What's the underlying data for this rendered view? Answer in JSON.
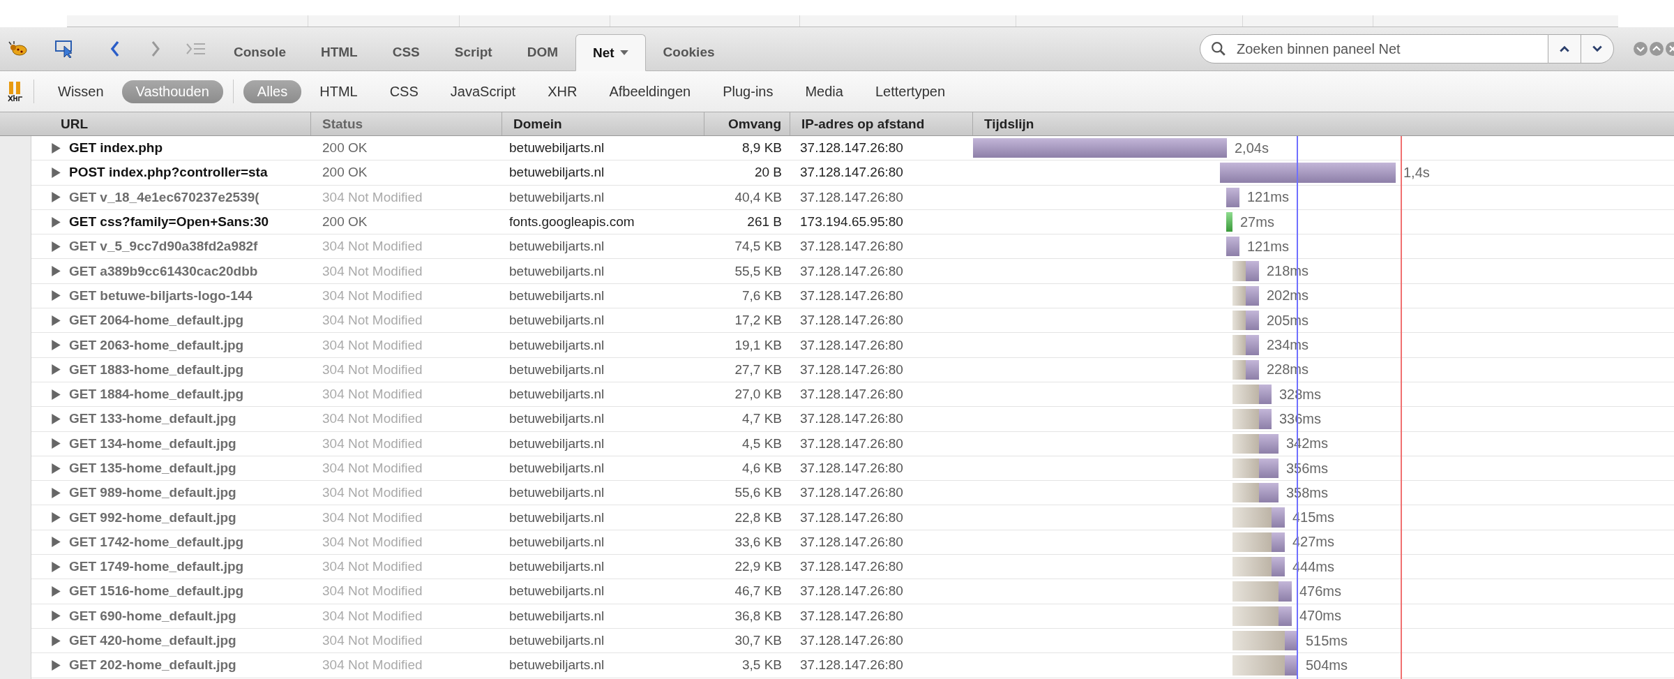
{
  "panel_tabs": [
    {
      "label": "Console",
      "selected": false
    },
    {
      "label": "HTML",
      "selected": false
    },
    {
      "label": "CSS",
      "selected": false
    },
    {
      "label": "Script",
      "selected": false
    },
    {
      "label": "DOM",
      "selected": false
    },
    {
      "label": "Net",
      "selected": true
    },
    {
      "label": "Cookies",
      "selected": false
    }
  ],
  "search": {
    "placeholder": "Zoeken binnen paneel Net"
  },
  "actions": [
    {
      "label": "Wissen",
      "selected": false
    },
    {
      "label": "Vasthouden",
      "selected": true
    }
  ],
  "filters": [
    {
      "label": "Alles",
      "selected": true
    },
    {
      "label": "HTML",
      "selected": false
    },
    {
      "label": "CSS",
      "selected": false
    },
    {
      "label": "JavaScript",
      "selected": false
    },
    {
      "label": "XHR",
      "selected": false
    },
    {
      "label": "Afbeeldingen",
      "selected": false
    },
    {
      "label": "Plug-ins",
      "selected": false
    },
    {
      "label": "Media",
      "selected": false
    },
    {
      "label": "Lettertypen",
      "selected": false
    }
  ],
  "table": {
    "columns": [
      "URL",
      "Status",
      "Domein",
      "Omvang",
      "IP-adres op afstand",
      "Tijdslijn"
    ],
    "rows": [
      {
        "url": "GET index.php",
        "status": "200 OK",
        "domain": "betuwebiljarts.nl",
        "size": "8,9 KB",
        "ip": "37.128.147.26:80",
        "time": "2,04s",
        "cached": false
      },
      {
        "url": "POST index.php?controller=sta",
        "status": "200 OK",
        "domain": "betuwebiljarts.nl",
        "size": "20 B",
        "ip": "37.128.147.26:80",
        "time": "1,4s",
        "cached": false
      },
      {
        "url": "GET v_18_4e1ec670237e2539(",
        "status": "304 Not Modified",
        "domain": "betuwebiljarts.nl",
        "size": "40,4 KB",
        "ip": "37.128.147.26:80",
        "time": "121ms",
        "cached": true
      },
      {
        "url": "GET css?family=Open+Sans:30",
        "status": "200 OK",
        "domain": "fonts.googleapis.com",
        "size": "261 B",
        "ip": "173.194.65.95:80",
        "time": "27ms",
        "cached": false
      },
      {
        "url": "GET v_5_9cc7d90a38fd2a982f",
        "status": "304 Not Modified",
        "domain": "betuwebiljarts.nl",
        "size": "74,5 KB",
        "ip": "37.128.147.26:80",
        "time": "121ms",
        "cached": true
      },
      {
        "url": "GET a389b9cc61430cac20dbb",
        "status": "304 Not Modified",
        "domain": "betuwebiljarts.nl",
        "size": "55,5 KB",
        "ip": "37.128.147.26:80",
        "time": "218ms",
        "cached": true
      },
      {
        "url": "GET betuwe-biljarts-logo-144",
        "status": "304 Not Modified",
        "domain": "betuwebiljarts.nl",
        "size": "7,6 KB",
        "ip": "37.128.147.26:80",
        "time": "202ms",
        "cached": true
      },
      {
        "url": "GET 2064-home_default.jpg",
        "status": "304 Not Modified",
        "domain": "betuwebiljarts.nl",
        "size": "17,2 KB",
        "ip": "37.128.147.26:80",
        "time": "205ms",
        "cached": true
      },
      {
        "url": "GET 2063-home_default.jpg",
        "status": "304 Not Modified",
        "domain": "betuwebiljarts.nl",
        "size": "19,1 KB",
        "ip": "37.128.147.26:80",
        "time": "234ms",
        "cached": true
      },
      {
        "url": "GET 1883-home_default.jpg",
        "status": "304 Not Modified",
        "domain": "betuwebiljarts.nl",
        "size": "27,7 KB",
        "ip": "37.128.147.26:80",
        "time": "228ms",
        "cached": true
      },
      {
        "url": "GET 1884-home_default.jpg",
        "status": "304 Not Modified",
        "domain": "betuwebiljarts.nl",
        "size": "27,0 KB",
        "ip": "37.128.147.26:80",
        "time": "328ms",
        "cached": true
      },
      {
        "url": "GET 133-home_default.jpg",
        "status": "304 Not Modified",
        "domain": "betuwebiljarts.nl",
        "size": "4,7 KB",
        "ip": "37.128.147.26:80",
        "time": "336ms",
        "cached": true
      },
      {
        "url": "GET 134-home_default.jpg",
        "status": "304 Not Modified",
        "domain": "betuwebiljarts.nl",
        "size": "4,5 KB",
        "ip": "37.128.147.26:80",
        "time": "342ms",
        "cached": true
      },
      {
        "url": "GET 135-home_default.jpg",
        "status": "304 Not Modified",
        "domain": "betuwebiljarts.nl",
        "size": "4,6 KB",
        "ip": "37.128.147.26:80",
        "time": "356ms",
        "cached": true
      },
      {
        "url": "GET 989-home_default.jpg",
        "status": "304 Not Modified",
        "domain": "betuwebiljarts.nl",
        "size": "55,6 KB",
        "ip": "37.128.147.26:80",
        "time": "358ms",
        "cached": true
      },
      {
        "url": "GET 992-home_default.jpg",
        "status": "304 Not Modified",
        "domain": "betuwebiljarts.nl",
        "size": "22,8 KB",
        "ip": "37.128.147.26:80",
        "time": "415ms",
        "cached": true
      },
      {
        "url": "GET 1742-home_default.jpg",
        "status": "304 Not Modified",
        "domain": "betuwebiljarts.nl",
        "size": "33,6 KB",
        "ip": "37.128.147.26:80",
        "time": "427ms",
        "cached": true
      },
      {
        "url": "GET 1749-home_default.jpg",
        "status": "304 Not Modified",
        "domain": "betuwebiljarts.nl",
        "size": "22,9 KB",
        "ip": "37.128.147.26:80",
        "time": "444ms",
        "cached": true
      },
      {
        "url": "GET 1516-home_default.jpg",
        "status": "304 Not Modified",
        "domain": "betuwebiljarts.nl",
        "size": "46,7 KB",
        "ip": "37.128.147.26:80",
        "time": "476ms",
        "cached": true
      },
      {
        "url": "GET 690-home_default.jpg",
        "status": "304 Not Modified",
        "domain": "betuwebiljarts.nl",
        "size": "36,8 KB",
        "ip": "37.128.147.26:80",
        "time": "470ms",
        "cached": true
      },
      {
        "url": "GET 420-home_default.jpg",
        "status": "304 Not Modified",
        "domain": "betuwebiljarts.nl",
        "size": "30,7 KB",
        "ip": "37.128.147.26:80",
        "time": "515ms",
        "cached": true
      },
      {
        "url": "GET 202-home_default.jpg",
        "status": "304 Not Modified",
        "domain": "betuwebiljarts.nl",
        "size": "3,5 KB",
        "ip": "37.128.147.26:80",
        "time": "504ms",
        "cached": true
      }
    ]
  }
}
